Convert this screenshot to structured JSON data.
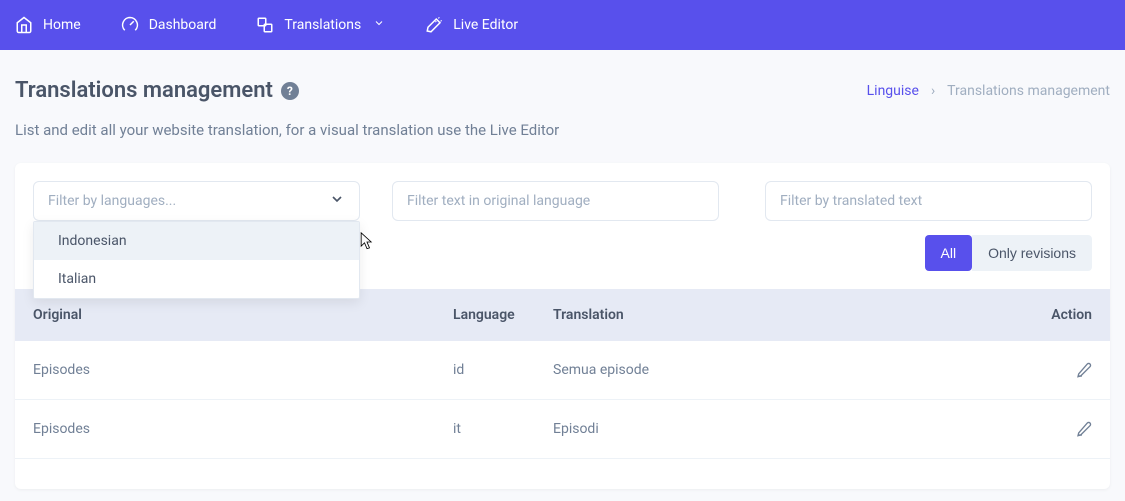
{
  "nav": {
    "home": "Home",
    "dashboard": "Dashboard",
    "translations": "Translations",
    "live_editor": "Live Editor"
  },
  "header": {
    "title": "Translations management",
    "breadcrumb_link": "Linguise",
    "breadcrumb_current": "Translations management"
  },
  "subtitle": "List and edit all your website translation, for a visual translation use the Live Editor",
  "filters": {
    "lang_placeholder": "Filter by languages...",
    "orig_placeholder": "Filter text in original language",
    "trans_placeholder": "Filter by translated text"
  },
  "dropdown": {
    "items": [
      {
        "label": "Indonesian"
      },
      {
        "label": "Italian"
      }
    ]
  },
  "toggle": {
    "all": "All",
    "revisions": "Only revisions"
  },
  "table": {
    "headers": {
      "original": "Original",
      "language": "Language",
      "translation": "Translation",
      "action": "Action"
    },
    "rows": [
      {
        "original": "Episodes",
        "language": "id",
        "translation": "Semua episode"
      },
      {
        "original": "Episodes",
        "language": "it",
        "translation": "Episodi"
      }
    ]
  }
}
